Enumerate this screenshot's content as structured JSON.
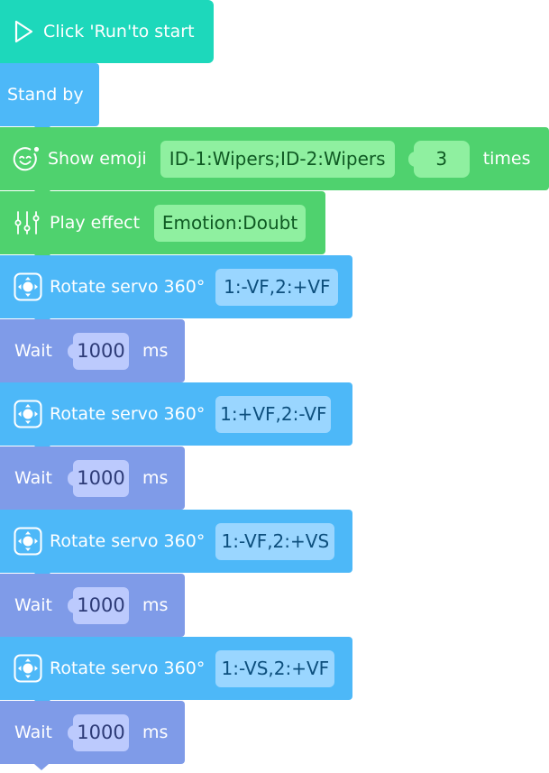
{
  "program": {
    "start": {
      "label": "Click 'Run'to start",
      "icon": "play-icon"
    },
    "standby": {
      "label": "Stand by"
    },
    "show_emoji": {
      "label": "Show emoji",
      "emoji_value": "ID-1:Wipers;ID-2:Wipers",
      "times_value": "3",
      "times_label": "times",
      "icon": "emoji-icon"
    },
    "play_effect": {
      "label": "Play effect",
      "value": "Emotion:Doubt",
      "icon": "equalizer-icon"
    },
    "steps": [
      {
        "rotate_label": "Rotate servo 360°",
        "rotate_value": "1:-VF,2:+VF",
        "wait_label": "Wait",
        "wait_value": "1000",
        "wait_unit": "ms"
      },
      {
        "rotate_label": "Rotate servo 360°",
        "rotate_value": "1:+VF,2:-VF",
        "wait_label": "Wait",
        "wait_value": "1000",
        "wait_unit": "ms"
      },
      {
        "rotate_label": "Rotate servo 360°",
        "rotate_value": "1:-VF,2:+VS",
        "wait_label": "Wait",
        "wait_value": "1000",
        "wait_unit": "ms"
      },
      {
        "rotate_label": "Rotate servo 360°",
        "rotate_value": "1:-VS,2:+VF",
        "wait_label": "Wait",
        "wait_value": "1000",
        "wait_unit": "ms"
      }
    ]
  },
  "colors": {
    "event": "#1dd8bb",
    "motion": "#4db8f8",
    "display": "#4fd26e",
    "control": "#7f9be8"
  }
}
